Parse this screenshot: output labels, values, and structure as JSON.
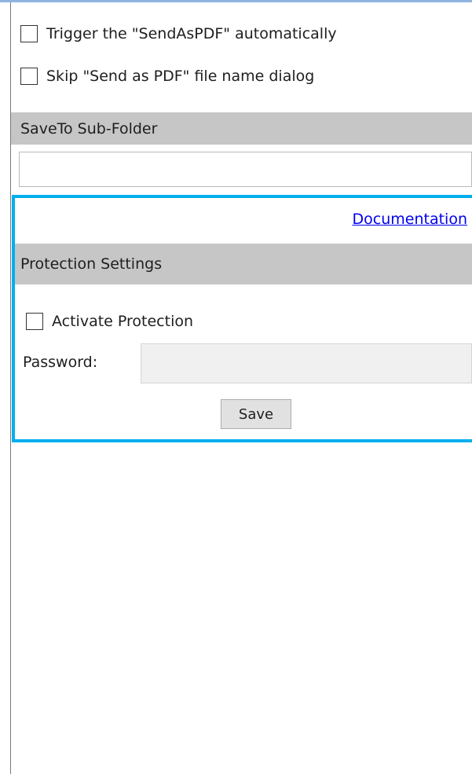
{
  "options": {
    "trigger_auto_label": "Trigger the \"SendAsPDF\" automatically",
    "skip_dialog_label": "Skip \"Send as PDF\" file name dialog"
  },
  "subfolder": {
    "header": "SaveTo Sub-Folder",
    "value": ""
  },
  "protection": {
    "documentation_link": "Documentation",
    "header": "Protection Settings",
    "activate_label": "Activate Protection",
    "password_label": "Password:",
    "password_value": "",
    "save_label": "Save"
  },
  "colors": {
    "highlight_border": "#00aeef",
    "section_header_bg": "#c6c6c6",
    "link": "#0000ee"
  }
}
